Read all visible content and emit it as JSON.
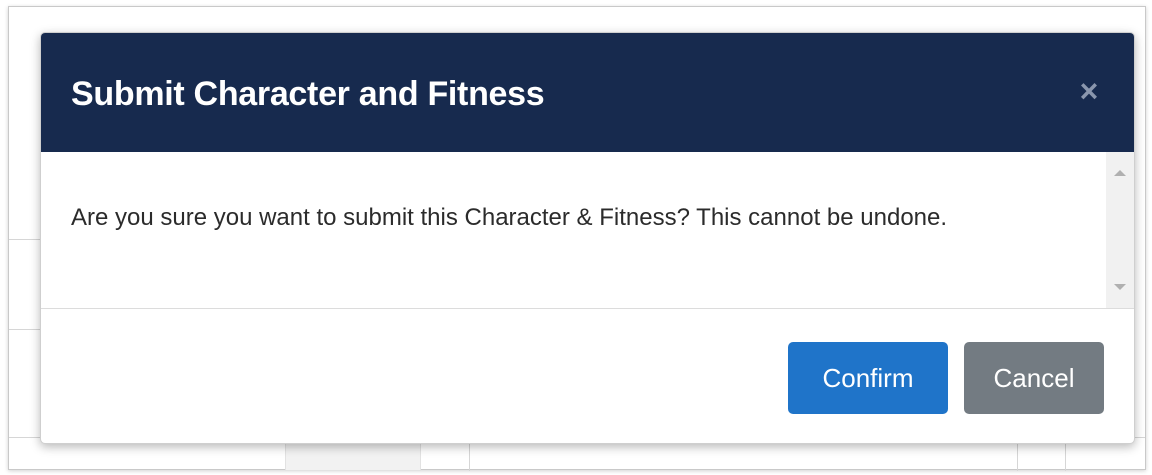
{
  "modal": {
    "title": "Submit Character and Fitness",
    "close_symbol": "×",
    "message": "Are you sure you want to submit this Character & Fitness? This cannot be undone.",
    "confirm_label": "Confirm",
    "cancel_label": "Cancel"
  },
  "colors": {
    "header_bg": "#172a4e",
    "confirm_bg": "#1f74c9",
    "cancel_bg": "#737b82"
  },
  "icons": {
    "close": "close-icon",
    "scroll_up": "scroll-up-arrow-icon",
    "scroll_down": "scroll-down-arrow-icon"
  }
}
